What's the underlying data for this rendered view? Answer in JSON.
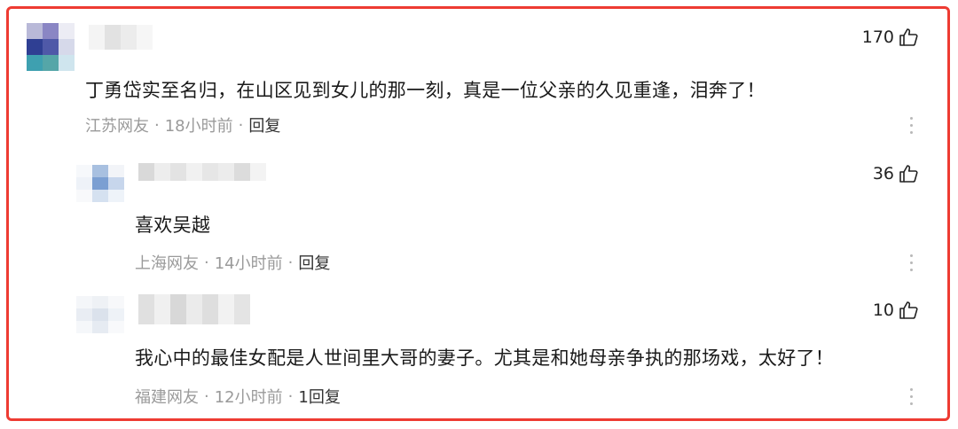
{
  "comments": [
    {
      "likes": "170",
      "text": "丁勇岱实至名归，在山区见到女儿的那一刻，真是一位父亲的久见重逢，泪奔了！",
      "location": "江苏网友",
      "time": "18小时前",
      "reply": "回复"
    },
    {
      "likes": "36",
      "text": "喜欢吴越",
      "location": "上海网友",
      "time": "14小时前",
      "reply": "回复"
    },
    {
      "likes": "10",
      "text": "我心中的最佳女配是人世间里大哥的妻子。尤其是和她母亲争执的那场戏，太好了！",
      "location": "福建网友",
      "time": "12小时前",
      "reply": "1回复"
    }
  ],
  "separator": "·",
  "colors": {
    "highlight_border": "#ee3b32",
    "meta_text": "#9a9a9a"
  },
  "icons": {
    "like": "thumbs-up-icon",
    "more": "more-vertical-icon"
  }
}
